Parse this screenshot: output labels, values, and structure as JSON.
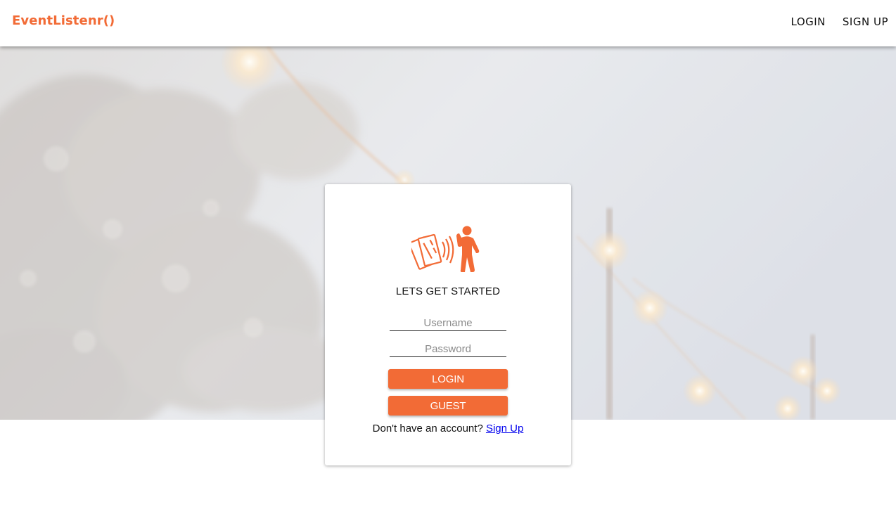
{
  "app": {
    "brand": "EventListenr()"
  },
  "nav": {
    "login": "LOGIN",
    "signup": "SIGN UP"
  },
  "colors": {
    "accent": "#f26b36",
    "link": "#0000ee"
  },
  "login_card": {
    "logo_icon": "tickets-and-person-icon",
    "heading": "LETS GET STARTED",
    "username_placeholder": "Username",
    "username_value": "",
    "password_placeholder": "Password",
    "password_value": "",
    "login_button": "LOGIN",
    "guest_button": "GUEST",
    "prompt": "Don't have an account?",
    "signup_link": "Sign Up"
  }
}
